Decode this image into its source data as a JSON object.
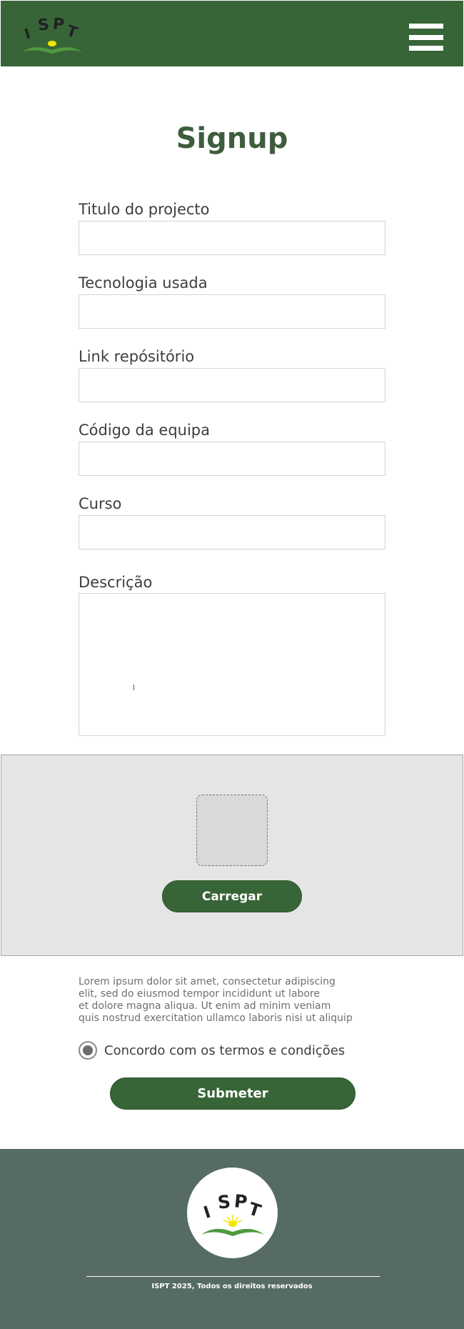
{
  "header": {
    "logo_text": "ISPT",
    "menu_icon": "hamburger-menu-icon"
  },
  "page": {
    "title": "Signup"
  },
  "form": {
    "fields": [
      {
        "label": "Titulo do projecto",
        "value": ""
      },
      {
        "label": "Tecnologia usada",
        "value": ""
      },
      {
        "label": "Link repósitório",
        "value": ""
      },
      {
        "label": "Código da equipa",
        "value": ""
      },
      {
        "label": "Curso",
        "value": ""
      }
    ],
    "description": {
      "label": "Descrição",
      "value": ""
    }
  },
  "upload": {
    "button_label": "Carregar"
  },
  "terms": {
    "text_lines": [
      "Lorem ipsum dolor sit amet, consectetur adipiscing",
      "elit, sed do eiusmod tempor incididunt ut labore",
      "et dolore magna aliqua. Ut enim ad minim veniam",
      "quis nostrud exercitation ullamco laboris nisi ut aliquip"
    ],
    "agree_label": "Concordo com os termos e condições",
    "agree_checked": true
  },
  "submit": {
    "label": "Submeter"
  },
  "footer": {
    "logo_text": "ISPT",
    "copyright": "ISPT 2025, Todos os direitos reservados"
  },
  "colors": {
    "brand_green": "#386537",
    "title_green": "#3e5d3d",
    "footer_bg": "#566b64",
    "logo_yellow": "#f2e500",
    "logo_green": "#4f9a3f"
  }
}
